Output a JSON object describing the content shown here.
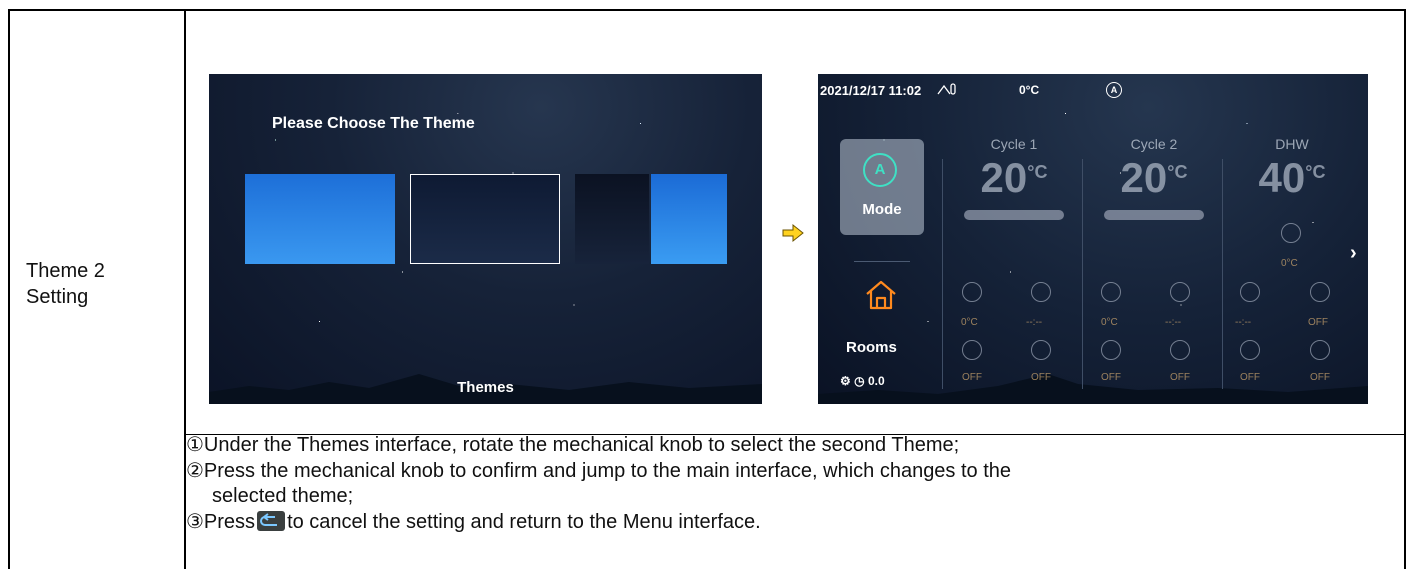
{
  "row_label": {
    "line1": "Theme 2",
    "line2": "Setting"
  },
  "screen1": {
    "title": "Please Choose The Theme",
    "footer": "Themes"
  },
  "screen2": {
    "datetime": "2021/12/17 11:02",
    "outdoor_temp": "0°C",
    "auto_symbol": "A",
    "mode_label": "Mode",
    "mode_icon_text": "A",
    "rooms_label": "Rooms",
    "pressure": "0.0",
    "columns": [
      {
        "title": "Cycle 1",
        "temp": "20",
        "unit": "°C"
      },
      {
        "title": "Cycle 2",
        "temp": "20",
        "unit": "°C"
      },
      {
        "title": "DHW",
        "temp": "40",
        "unit": "°C"
      }
    ],
    "dhw_small": "0°C",
    "sub_values": {
      "c1a": "0°C",
      "c1b": "--:--",
      "c2a": "0°C",
      "c2b": "--:--",
      "c3a": "--:--",
      "c3b": "OFF",
      "c1c": "OFF",
      "c1d": "OFF",
      "c2c": "OFF",
      "c2d": "OFF",
      "c3c": "OFF",
      "c3d": "OFF"
    }
  },
  "instructions": {
    "line1": "①Under the Themes interface, rotate the mechanical knob to select the second Theme;",
    "line2": "②Press the mechanical knob to confirm and jump to the main interface, which changes to the",
    "line3": "selected theme;",
    "line4a": "③Press",
    "line4b": "to cancel the setting and return to the Menu interface."
  }
}
